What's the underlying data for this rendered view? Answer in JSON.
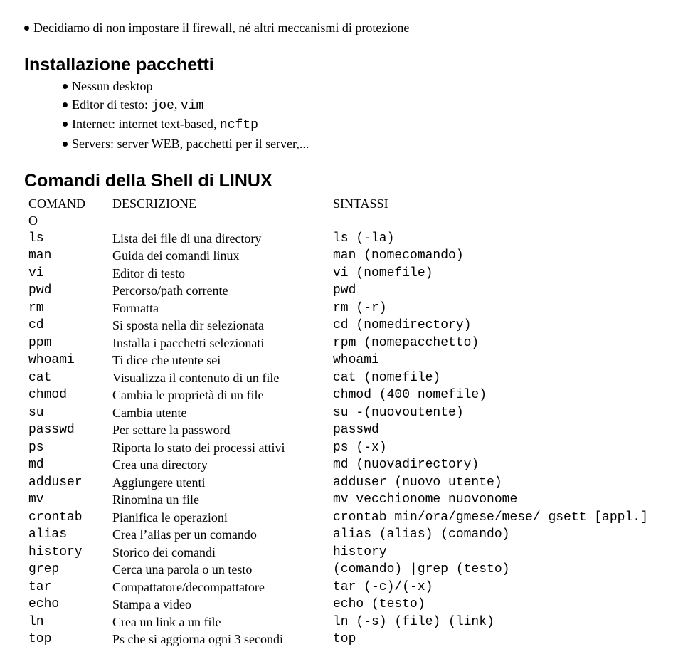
{
  "top_bullet": "Decidiamo di non impostare il firewall, né altri meccanismi di protezione",
  "section1": {
    "title": "Installazione pacchetti",
    "items": [
      {
        "parts": [
          {
            "t": "Nessun desktop"
          }
        ]
      },
      {
        "parts": [
          {
            "t": "Editor di testo: "
          },
          {
            "t": "joe",
            "mono": true
          },
          {
            "t": ", "
          },
          {
            "t": "vim",
            "mono": true
          }
        ]
      },
      {
        "parts": [
          {
            "t": "Internet: internet text-based, "
          },
          {
            "t": "ncftp",
            "mono": true
          }
        ]
      },
      {
        "parts": [
          {
            "t": "Servers: server WEB, pacchetti per il server,..."
          }
        ]
      }
    ]
  },
  "section2": {
    "title": "Comandi della Shell di LINUX",
    "header": {
      "c1": "COMANDO",
      "c2": "DESCRIZIONE",
      "c3": "SINTASSI"
    },
    "rows": [
      {
        "c1": "ls",
        "c2": "Lista dei file di una directory",
        "c3": "ls (-la)"
      },
      {
        "c1": "man",
        "c2": "Guida dei comandi linux",
        "c3": "man (nomecomando)"
      },
      {
        "c1": "vi",
        "c2": "Editor di testo",
        "c3": "vi (nomefile)"
      },
      {
        "c1": "pwd",
        "c2": "Percorso/path corrente",
        "c3": "pwd"
      },
      {
        "c1": "rm",
        "c2": "Formatta",
        "c3": "rm (-r)"
      },
      {
        "c1": "cd",
        "c2": "Si sposta nella dir selezionata",
        "c3": "cd (nomedirectory)"
      },
      {
        "c1": "ppm",
        "c2": "Installa i pacchetti selezionati",
        "c3": "rpm (nomepacchetto)"
      },
      {
        "c1": "whoami",
        "c2": "Ti dice che utente sei",
        "c3": "whoami"
      },
      {
        "c1": "cat",
        "c2": "Visualizza il contenuto di un file",
        "c3": "cat (nomefile)"
      },
      {
        "c1": "chmod",
        "c2": "Cambia le proprietà di un file",
        "c3": "chmod (400 nomefile)"
      },
      {
        "c1": "su",
        "c2": "Cambia utente",
        "c3": "su -(nuovoutente)"
      },
      {
        "c1": "passwd",
        "c2": "Per settare la password",
        "c3": "passwd"
      },
      {
        "c1": "ps",
        "c2": "Riporta lo stato dei processi attivi",
        "c3": "ps (-x)"
      },
      {
        "c1": "md",
        "c2": "Crea una directory",
        "c3": "md (nuovadirectory)"
      },
      {
        "c1": "adduser",
        "c2": "Aggiungere utenti",
        "c3": "adduser (nuovo utente)"
      },
      {
        "c1": "mv",
        "c2": "Rinomina un file",
        "c3": "mv vecchionome nuovonome"
      },
      {
        "c1": "crontab",
        "c2": "Pianifica le operazioni",
        "c3": "crontab min/ora/gmese/mese/ gsett [appl.]"
      },
      {
        "c1": "alias",
        "c2": "Crea l’alias per un comando",
        "c3": "alias (alias) (comando)"
      },
      {
        "c1": "history",
        "c2": "Storico dei comandi",
        "c3": "history"
      },
      {
        "c1": "grep",
        "c2": "Cerca una parola o un testo",
        "c3": "(comando) |grep (testo)"
      },
      {
        "c1": "tar",
        "c2": "Compattatore/decompattatore",
        "c3": "tar (-c)/(-x)"
      },
      {
        "c1": "echo",
        "c2": "Stampa a video",
        "c3": "echo (testo)"
      },
      {
        "c1": "ln",
        "c2": "Crea un link a un file",
        "c3": "ln (-s) (file) (link)"
      },
      {
        "c1": "top",
        "c2": "Ps che si aggiorna ogni 3 secondi",
        "c3": "top"
      }
    ]
  }
}
